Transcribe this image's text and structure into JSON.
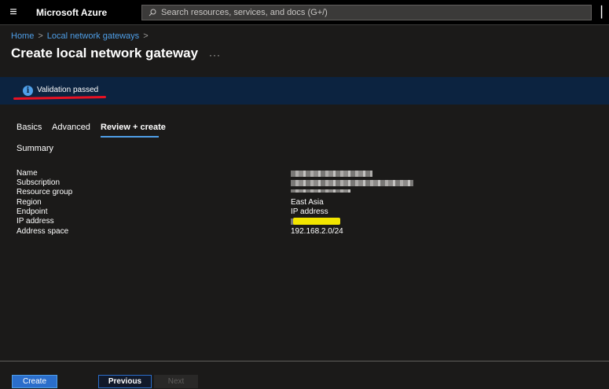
{
  "topbar": {
    "brand": "Microsoft Azure",
    "search_placeholder": "Search resources, services, and docs (G+/)",
    "menu_icon": "hamburger-icon",
    "search_icon": "search-icon"
  },
  "breadcrumb": {
    "items": [
      "Home",
      "Local network gateways"
    ],
    "separator": ">"
  },
  "page": {
    "title": "Create local network gateway",
    "more": "···"
  },
  "validation": {
    "icon": "info-icon",
    "text": "Validation passed",
    "colors": {
      "banner": "#0c2340",
      "icon": "#4f9fe8",
      "underline": "#e81123"
    }
  },
  "tabs": [
    {
      "label": "Basics",
      "active": false
    },
    {
      "label": "Advanced",
      "active": false
    },
    {
      "label": "Review + create",
      "active": true
    }
  ],
  "summary": {
    "heading": "Summary",
    "rows": [
      {
        "label": "Name",
        "value": "",
        "redacted": true
      },
      {
        "label": "Subscription",
        "value": "",
        "redacted": true
      },
      {
        "label": "Resource group",
        "value": "",
        "redacted": true
      },
      {
        "label": "Region",
        "value": "East Asia",
        "redacted": false
      },
      {
        "label": "Endpoint",
        "value": "IP address",
        "redacted": false
      },
      {
        "label": "IP address",
        "value": "",
        "redacted": true,
        "highlighted": true
      },
      {
        "label": "Address space",
        "value": "192.168.2.0/24",
        "redacted": false
      }
    ]
  },
  "footer": {
    "create_label": "Create",
    "previous_label": "Previous",
    "next_label": "Next",
    "next_disabled": true
  },
  "colors": {
    "accent": "#2b6ecb",
    "link": "#4f9fe8",
    "background": "#1b1a19",
    "highlight": "#f2e500"
  }
}
